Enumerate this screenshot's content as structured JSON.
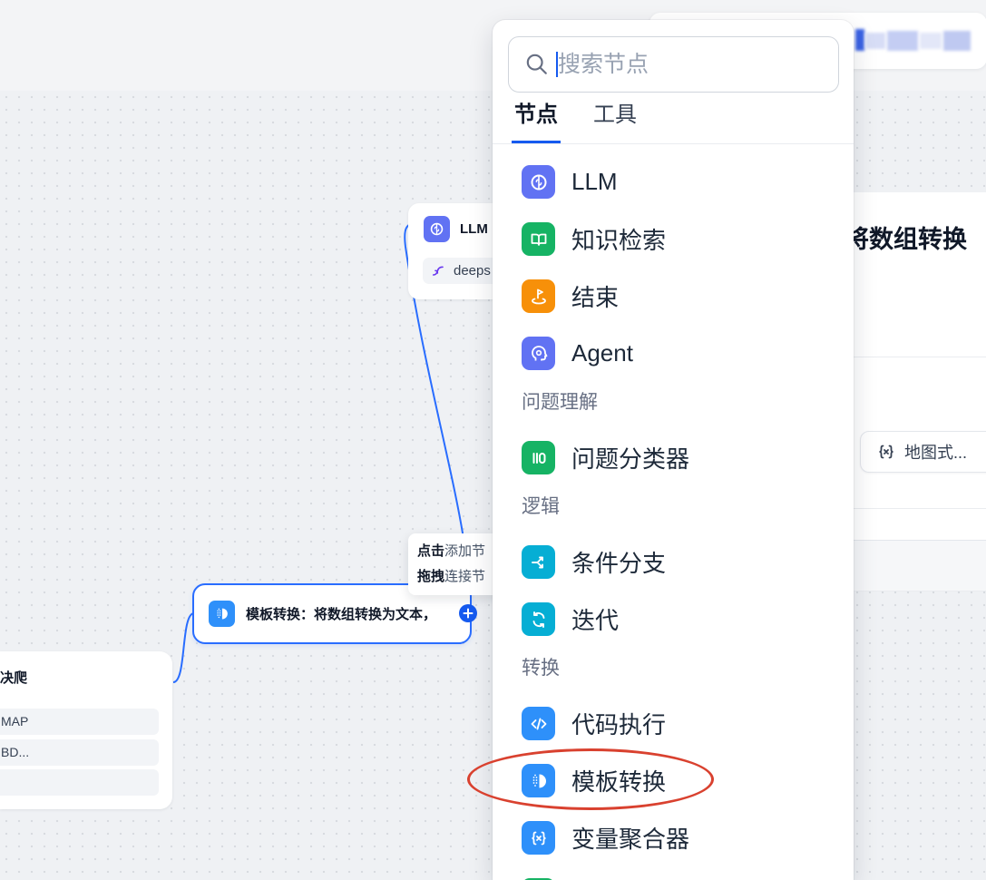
{
  "node_selector": {
    "search": {
      "placeholder": "搜索节点",
      "icon": "search-icon"
    },
    "tabs": [
      {
        "label": "节点",
        "active": true
      },
      {
        "label": "工具",
        "active": false
      }
    ],
    "sections": [
      {
        "items": [
          {
            "label": "LLM",
            "icon": "brain-icon",
            "color": "#6172f3"
          },
          {
            "label": "知识检索",
            "icon": "book-icon",
            "color": "#16b364"
          },
          {
            "label": "结束",
            "icon": "flag-icon",
            "color": "#f79009"
          },
          {
            "label": "Agent",
            "icon": "agent-icon",
            "color": "#6172f3"
          }
        ]
      },
      {
        "header": "问题理解",
        "items": [
          {
            "label": "问题分类器",
            "icon": "classifier-icon",
            "color": "#16b364"
          }
        ]
      },
      {
        "header": "逻辑",
        "items": [
          {
            "label": "条件分支",
            "icon": "branch-icon",
            "color": "#06aed4"
          },
          {
            "label": "迭代",
            "icon": "loop-icon",
            "color": "#06aed4"
          }
        ]
      },
      {
        "header": "转换",
        "items": [
          {
            "label": "代码执行",
            "icon": "code-icon",
            "color": "#2e90fa"
          },
          {
            "label": "模板转换",
            "icon": "template-icon",
            "color": "#2e90fa",
            "highlighted": true
          },
          {
            "label": "变量聚合器",
            "icon": "variable-aggregator-icon",
            "color": "#2e90fa"
          },
          {
            "icon": "document-icon",
            "color": "#16b364"
          }
        ]
      }
    ]
  },
  "canvas": {
    "llm_node": {
      "title": "LLM",
      "icon": "brain-icon",
      "color": "#6172f3",
      "model": "deeps",
      "model_icon": "deepseek-icon"
    },
    "template_node": {
      "title": "模板转换：将数组转换为文本，",
      "icon": "template-icon",
      "color": "#2e90fa",
      "selected": true
    },
    "add_node_tooltip": {
      "click_strong": "点击",
      "click_text": "添加节",
      "drag_strong": "拖拽",
      "drag_text": "连接节"
    },
    "crawler_node": {
      "title": "决爬",
      "rows": [
        "MAP",
        "BD..."
      ]
    }
  },
  "right_panel": {
    "title": "将数组转换",
    "variable_chip": {
      "icon": "variable-icon",
      "label": "地图式..."
    }
  },
  "colors": {
    "accent": "#155aef",
    "selected_border": "#296dff",
    "annotation_red": "#d9412f"
  }
}
